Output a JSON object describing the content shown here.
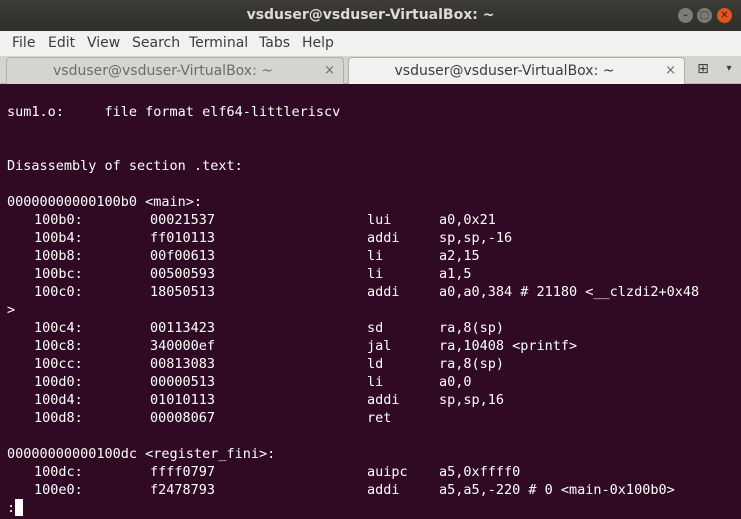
{
  "window": {
    "title": "vsduser@vsduser-VirtualBox: ~",
    "minimize_icon": "–",
    "maximize_icon": "□",
    "close_icon": "✕"
  },
  "menu": [
    "File",
    "Edit",
    "View",
    "Search",
    "Terminal",
    "Tabs",
    "Help"
  ],
  "tabs": [
    {
      "label": "vsduser@vsduser-VirtualBox: ~",
      "close": "×"
    },
    {
      "label": "vsduser@vsduser-VirtualBox: ~",
      "close": "×"
    }
  ],
  "new_tab_icon": "⊞",
  "tab_menu_icon": "▾",
  "terminal": {
    "header_line": "sum1.o:     file format elf64-littleriscv",
    "section_line": "Disassembly of section .text:",
    "main_label": "00000000000100b0 <main>:",
    "main_insts": [
      {
        "addr": "100b0:",
        "hex": "00021537",
        "mnem": "lui",
        "ops": "a0,0x21"
      },
      {
        "addr": "100b4:",
        "hex": "ff010113",
        "mnem": "addi",
        "ops": "sp,sp,-16"
      },
      {
        "addr": "100b8:",
        "hex": "00f00613",
        "mnem": "li",
        "ops": "a2,15"
      },
      {
        "addr": "100bc:",
        "hex": "00500593",
        "mnem": "li",
        "ops": "a1,5"
      },
      {
        "addr": "100c0:",
        "hex": "18050513",
        "mnem": "addi",
        "ops": "a0,a0,384 # 21180 <__clzdi2+0x48"
      }
    ],
    "wrap_line": ">",
    "main_insts2": [
      {
        "addr": "100c4:",
        "hex": "00113423",
        "mnem": "sd",
        "ops": "ra,8(sp)"
      },
      {
        "addr": "100c8:",
        "hex": "340000ef",
        "mnem": "jal",
        "ops": "ra,10408 <printf>"
      },
      {
        "addr": "100cc:",
        "hex": "00813083",
        "mnem": "ld",
        "ops": "ra,8(sp)"
      },
      {
        "addr": "100d0:",
        "hex": "00000513",
        "mnem": "li",
        "ops": "a0,0"
      },
      {
        "addr": "100d4:",
        "hex": "01010113",
        "mnem": "addi",
        "ops": "sp,sp,16"
      },
      {
        "addr": "100d8:",
        "hex": "00008067",
        "mnem": "ret",
        "ops": ""
      }
    ],
    "fini_label": "00000000000100dc <register_fini>:",
    "fini_insts": [
      {
        "addr": "100dc:",
        "hex": "ffff0797",
        "mnem": "auipc",
        "ops": "a5,0xffff0"
      },
      {
        "addr": "100e0:",
        "hex": "f2478793",
        "mnem": "addi",
        "ops": "a5,a5,-220 # 0 <main-0x100b0>"
      }
    ],
    "prompt": ":"
  }
}
